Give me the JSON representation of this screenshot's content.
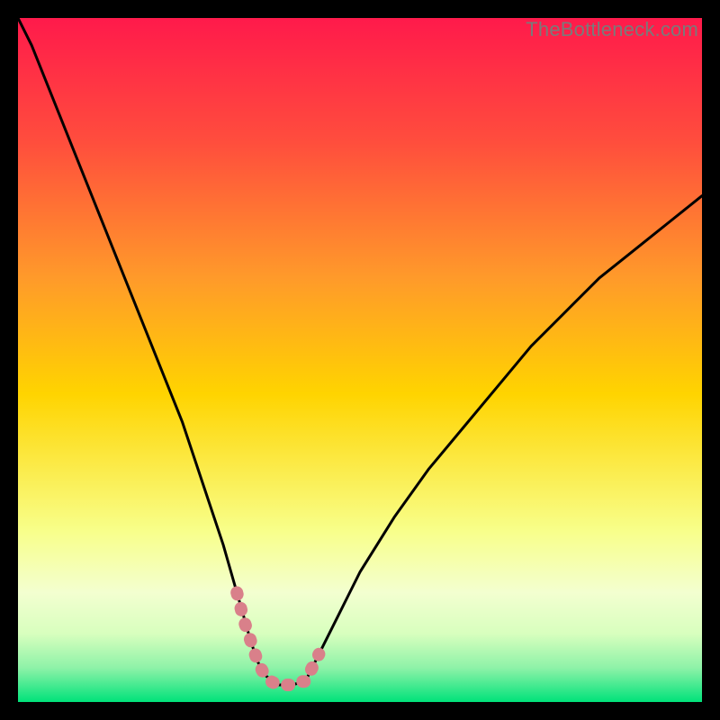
{
  "watermark": "TheBottleneck.com",
  "colors": {
    "bg_black": "#000000",
    "grad_top": "#ff1a4b",
    "grad_mid1": "#ff7a2a",
    "grad_mid2": "#ffd400",
    "grad_low1": "#f8ff8a",
    "grad_low2": "#d8ffbe",
    "grad_bottom": "#00e27a",
    "curve": "#000000",
    "highlight": "#d9808a"
  },
  "chart_data": {
    "type": "line",
    "title": "",
    "xlabel": "",
    "ylabel": "",
    "xlim": [
      0,
      100
    ],
    "ylim": [
      0,
      100
    ],
    "series": [
      {
        "name": "bottleneck-curve",
        "x": [
          0,
          2,
          4,
          6,
          8,
          10,
          12,
          14,
          16,
          18,
          20,
          22,
          24,
          26,
          28,
          30,
          32,
          34,
          35,
          36,
          38,
          40,
          42,
          43,
          44,
          46,
          48,
          50,
          55,
          60,
          65,
          70,
          75,
          80,
          85,
          90,
          95,
          100
        ],
        "y": [
          100,
          96,
          91,
          86,
          81,
          76,
          71,
          66,
          61,
          56,
          51,
          46,
          41,
          35,
          29,
          23,
          16,
          9,
          6,
          4,
          2.5,
          2.5,
          3,
          5,
          7,
          11,
          15,
          19,
          27,
          34,
          40,
          46,
          52,
          57,
          62,
          66,
          70,
          74
        ]
      },
      {
        "name": "highlight-valley",
        "x": [
          32,
          33,
          34,
          35,
          36,
          37,
          38,
          39,
          40,
          41,
          42,
          43,
          44
        ],
        "y": [
          16,
          12,
          9,
          6,
          4,
          3,
          2.5,
          2.5,
          2.5,
          3,
          3,
          5,
          7
        ]
      }
    ],
    "notes": "Background vertical gradient red→orange→yellow→pale→green. Black frame. Curve is a sharp V with minimum near x≈39, y≈2.5; left branch steeper than right. Pink/salmon thick dotted highlight along the valley floor."
  }
}
